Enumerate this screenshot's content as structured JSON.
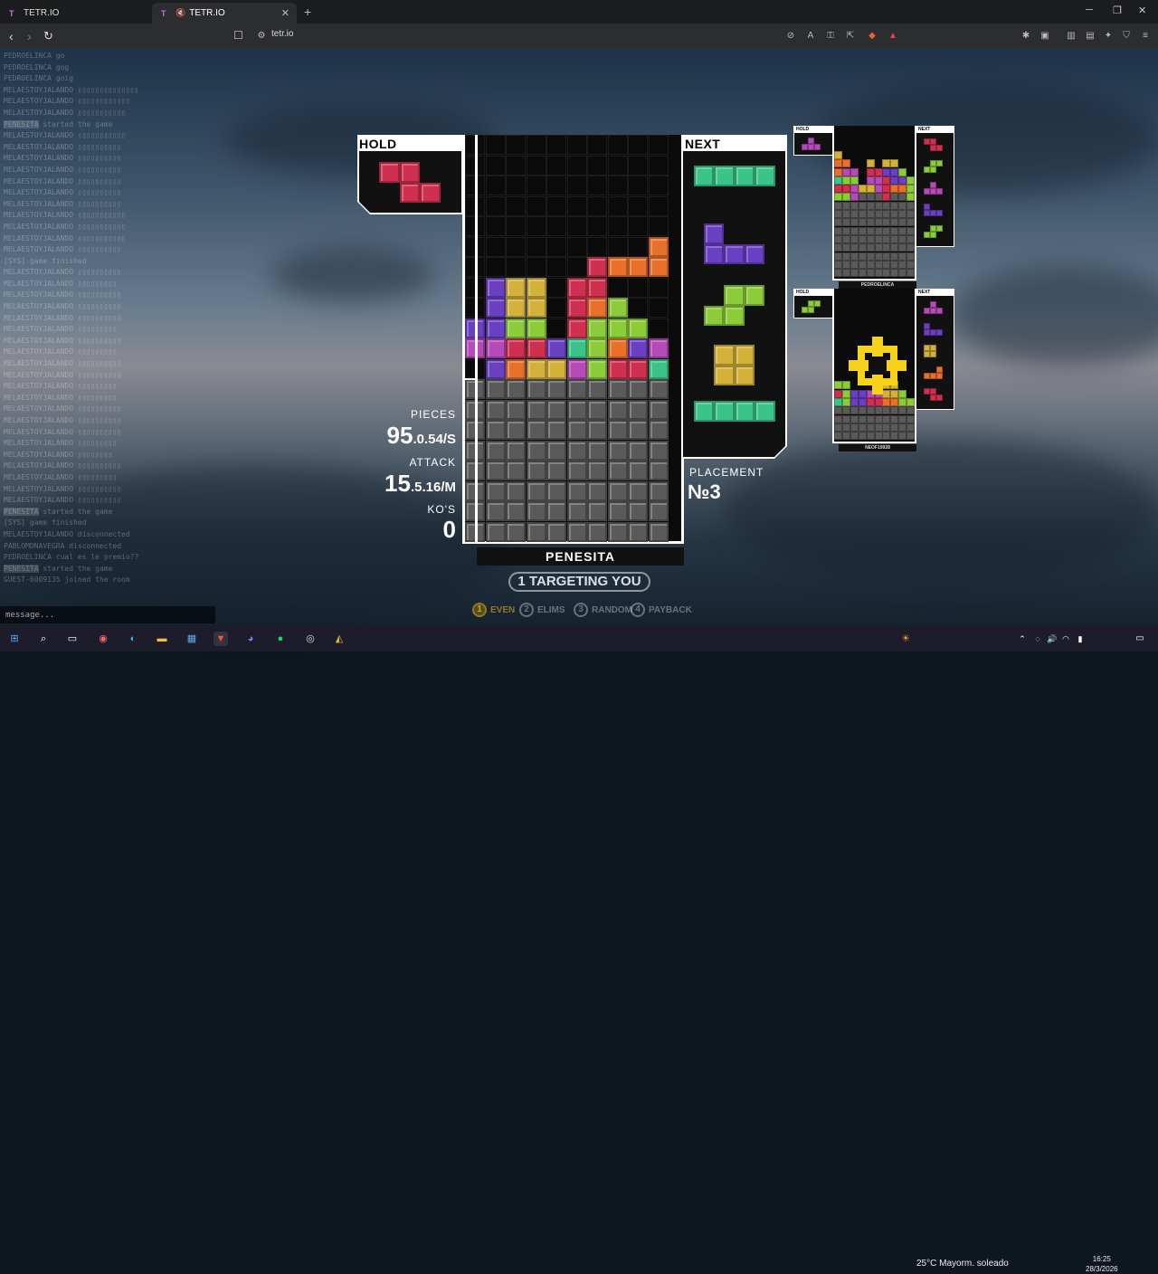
{
  "browser": {
    "tabs": [
      {
        "label": "TETR.IO"
      },
      {
        "label": "TETR.IO"
      }
    ],
    "url": "tetr.io",
    "new_tab": "+",
    "win_min": "─",
    "win_max": "❐",
    "win_close": "✕"
  },
  "chat": {
    "lines": [
      {
        "user": "PEDROELINCA",
        "text": "go"
      },
      {
        "user": "PEDROELINCA",
        "text": "gog"
      },
      {
        "user": "PEDROELINCA",
        "text": "goig"
      },
      {
        "user": "MELAESTOYJALANDO",
        "text": "▯▯▯▯▯▯▯▯▯▯▯▯▯▯"
      },
      {
        "user": "MELAESTOYJALANDO",
        "text": "▯▯▯▯▯▯▯▯▯▯▯▯"
      },
      {
        "user": "MELAESTOYJALANDO",
        "text": "▯▯▯▯▯▯▯▯▯▯▯"
      },
      {
        "user": "PENESITA",
        "text": "started the game",
        "hl": true
      },
      {
        "user": "MELAESTOYJALANDO",
        "text": "▯▯▯▯▯▯▯▯▯▯▯"
      },
      {
        "user": "MELAESTOYJALANDO",
        "text": "▯▯▯▯▯▯▯▯▯▯"
      },
      {
        "user": "MELAESTOYJALANDO",
        "text": "▯▯▯▯▯▯▯▯▯▯"
      },
      {
        "user": "MELAESTOYJALANDO",
        "text": "▯▯▯▯▯▯▯▯▯▯"
      },
      {
        "user": "MELAESTOYJALANDO",
        "text": "▯▯▯▯▯▯▯▯▯▯"
      },
      {
        "user": "MELAESTOYJALANDO",
        "text": "▯▯▯▯▯▯▯▯▯▯"
      },
      {
        "user": "MELAESTOYJALANDO",
        "text": "▯▯▯▯▯▯▯▯▯▯"
      },
      {
        "user": "MELAESTOYJALANDO",
        "text": "▯▯▯▯▯▯▯▯▯▯▯"
      },
      {
        "user": "MELAESTOYJALANDO",
        "text": "▯▯▯▯▯▯▯▯▯▯▯"
      },
      {
        "user": "MELAESTOYJALANDO",
        "text": "▯▯▯▯▯▯▯▯▯▯▯"
      },
      {
        "user": "MELAESTOYJALANDO",
        "text": "▯▯▯▯▯▯▯▯▯▯"
      },
      {
        "user": "[SYS]",
        "text": "game finished"
      },
      {
        "user": "MELAESTOYJALANDO",
        "text": "▯▯▯▯▯▯▯▯▯▯"
      },
      {
        "user": "MELAESTOYJALANDO",
        "text": "▯▯▯▯▯▯▯▯▯"
      },
      {
        "user": "MELAESTOYJALANDO",
        "text": "▯▯▯▯▯▯▯▯▯▯"
      },
      {
        "user": "MELAESTOYJALANDO",
        "text": "▯▯▯▯▯▯▯▯▯▯"
      },
      {
        "user": "MELAESTOYJALANDO",
        "text": "▯▯▯▯▯▯▯▯▯▯"
      },
      {
        "user": "MELAESTOYJALANDO",
        "text": "▯▯▯▯▯▯▯▯▯"
      },
      {
        "user": "MELAESTOYJALANDO",
        "text": "▯▯▯▯▯▯▯▯▯▯"
      },
      {
        "user": "MELAESTOYJALANDO",
        "text": "▯▯▯▯▯▯▯▯▯"
      },
      {
        "user": "MELAESTOYJALANDO",
        "text": "▯▯▯▯▯▯▯▯▯▯"
      },
      {
        "user": "MELAESTOYJALANDO",
        "text": "▯▯▯▯▯▯▯▯▯▯"
      },
      {
        "user": "MELAESTOYJALANDO",
        "text": "▯▯▯▯▯▯▯▯▯"
      },
      {
        "user": "MELAESTOYJALANDO",
        "text": "▯▯▯▯▯▯▯▯▯"
      },
      {
        "user": "MELAESTOYJALANDO",
        "text": "▯▯▯▯▯▯▯▯▯▯"
      },
      {
        "user": "MELAESTOYJALANDO",
        "text": "▯▯▯▯▯▯▯▯▯▯"
      },
      {
        "user": "MELAESTOYJALANDO",
        "text": "▯▯▯▯▯▯▯▯▯▯"
      },
      {
        "user": "MELAESTOYJALANDO",
        "text": "▯▯▯▯▯▯▯▯▯"
      },
      {
        "user": "MELAESTOYJALANDO",
        "text": "▯▯▯▯▯▯▯▯"
      },
      {
        "user": "MELAESTOYJALANDO",
        "text": "▯▯▯▯▯▯▯▯▯▯"
      },
      {
        "user": "MELAESTOYJALANDO",
        "text": "▯▯▯▯▯▯▯▯▯"
      },
      {
        "user": "MELAESTOYJALANDO",
        "text": "▯▯▯▯▯▯▯▯▯▯"
      },
      {
        "user": "MELAESTOYJALANDO",
        "text": "▯▯▯▯▯▯▯▯▯▯"
      },
      {
        "user": "PENESITA",
        "text": "started the game",
        "hl": true
      },
      {
        "user": "[SYS]",
        "text": "game finished"
      },
      {
        "user": "MELAESTOYJALANDO",
        "text": "disconnected"
      },
      {
        "user": "PABLOMONAVEGRA",
        "text": "disconnected"
      },
      {
        "user": "PEDROELINCA",
        "text": "cual es le premio??"
      },
      {
        "user": "PENESITA",
        "text": "started the game",
        "hl": true
      },
      {
        "user": "GUEST-6009135",
        "text": "joined the room"
      }
    ],
    "input_placeholder": "message..."
  },
  "player": {
    "hold_label": "HOLD",
    "next_label": "NEXT",
    "name": "PENESITA",
    "targeting": "1 TARGETING YOU",
    "stats": {
      "pieces_label": "PIECES",
      "pieces": "95",
      "pps": ".0.54/S",
      "attack_label": "ATTACK",
      "attack": "15",
      "apm": ".5.16/M",
      "kos_label": "KO'S",
      "kos": "0",
      "placement_label": "PLACEMENT",
      "placement": "№3"
    },
    "hold_piece": "Z",
    "next_queue": [
      "I",
      "J",
      "S",
      "O",
      "I"
    ]
  },
  "strategies": [
    {
      "n": "1",
      "label": "EVEN",
      "active": true
    },
    {
      "n": "2",
      "label": "ELIMS",
      "active": false
    },
    {
      "n": "3",
      "label": "RANDOM",
      "active": false
    },
    {
      "n": "4",
      "label": "PAYBACK",
      "active": false
    }
  ],
  "opponents": [
    {
      "name": "PEDROELINCA",
      "hold_label": "HOLD",
      "next_label": "NEXT",
      "hold": "T",
      "next": [
        "Z",
        "S",
        "T",
        "J",
        "S"
      ]
    },
    {
      "name": "NEOF19928",
      "hold_label": "HOLD",
      "next_label": "NEXT",
      "hold": "S",
      "next": [
        "T",
        "J",
        "O",
        "L",
        "Z"
      ]
    }
  ],
  "colors": {
    "Z": "#d0304f",
    "S": "#8ccc3a",
    "T": "#b54ab8",
    "J": "#6a3fc2",
    "L": "#e8702a",
    "O": "#d4b23a",
    "I": "#3bc48a",
    "garbage": "#5a5a5a",
    "empty": "#111111"
  },
  "board": [
    "..........",
    "..........",
    "..........",
    "..........",
    "..........",
    ".........L",
    "......ZLLL",
    ".JOO.ZZ...",
    ".JOO.ZLS..",
    "JJSS.ZSSS.",
    "TTZZJISLJT",
    ".JLOOTSZZI",
    "GGGGGGGGGG",
    "GGGGGGGGGG",
    "GGGGGGGGGG",
    "GGGGGGGGGG",
    "GGGGGGGGGG",
    "GGGGGGGGGG",
    "GGGGGGGGGG",
    "GGGGGGGGGG"
  ],
  "taskbar": {
    "weather": "25°C  Mayorm. soleado",
    "time": "16:25",
    "date": "28/3/2026"
  }
}
